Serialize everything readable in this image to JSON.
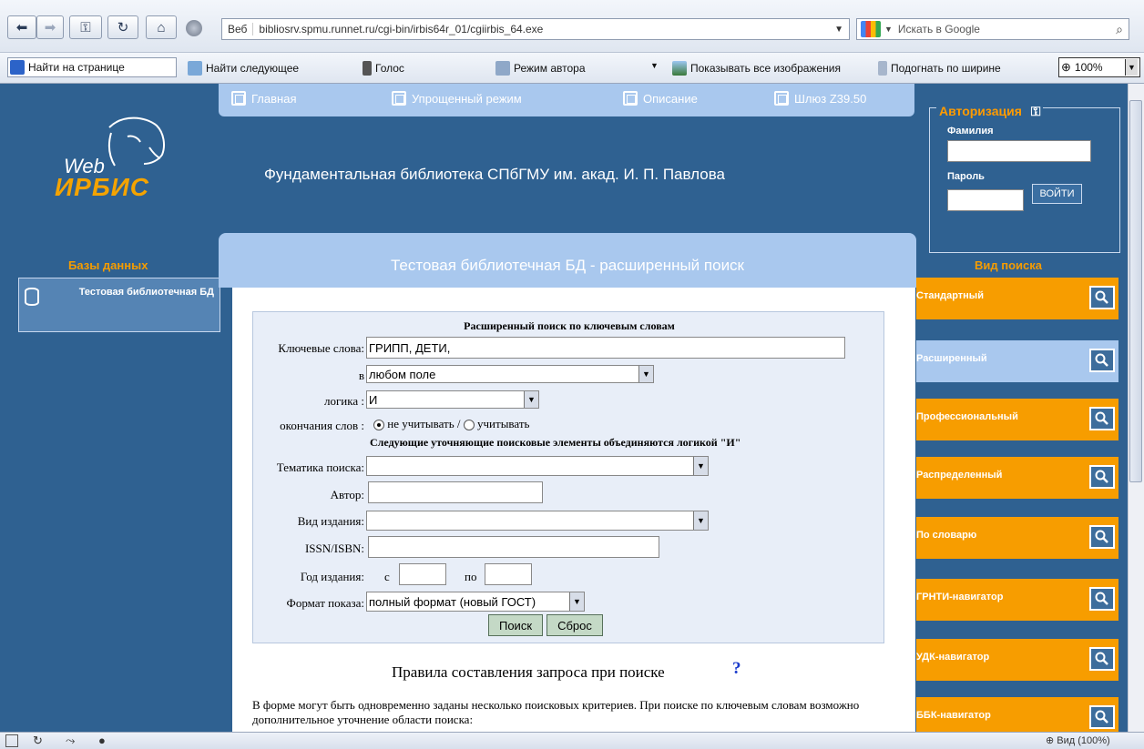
{
  "browser": {
    "address": "bibliosrv.spmu.runnet.ru/cgi-bin/irbis64r_01/cgiirbis_64.exe",
    "address_prefix": "Веб",
    "google_placeholder": "Искать в Google",
    "find_on_page": "Найти на странице",
    "find_next": "Найти следующее",
    "voice": "Голос",
    "author_mode": "Режим автора",
    "show_images": "Показывать все изображения",
    "fit_width": "Подогнать по ширине",
    "zoom": "100%",
    "status_zoom": "Вид (100%)"
  },
  "topnav": [
    "Главная",
    "Упрощенный режим",
    "Описание",
    "Шлюз Z39.50"
  ],
  "logo": {
    "web": "Web",
    "irbis": "ИРБИС"
  },
  "site_title": "Фундаментальная библиотека СПбГМУ им. акад. И. П. Павлова",
  "auth": {
    "title": "Авторизация",
    "surname_label": "Фамилия",
    "password_label": "Пароль",
    "login_button": "ВОЙТИ"
  },
  "databases": {
    "title": "Базы данных",
    "items": [
      "Тестовая библиотечная БД"
    ]
  },
  "search_header": "Тестовая библиотечная БД - расширенный поиск",
  "form": {
    "title": "Расширенный поиск по ключевым словам",
    "keywords_label": "Ключевые слова:",
    "keywords_value": "ГРИПП, ДЕТИ,",
    "in_label": "в",
    "in_value": "любом поле",
    "logic_label": "логика :",
    "logic_value": "И",
    "endings_label": "окончания слов :",
    "endings_opt1": "не учитывать /",
    "endings_opt2": "учитывать",
    "refine_note": "Следующие уточняющие поисковые элементы объединяются логикой \"И\"",
    "topic_label": "Тематика поиска:",
    "topic_value": "",
    "author_label": "Автор:",
    "author_value": "",
    "pubtype_label": "Вид издания:",
    "pubtype_value": "",
    "issn_label": "ISSN/ISBN:",
    "issn_value": "",
    "year_label": "Год издания:",
    "year_from_label": "с",
    "year_to_label": "по",
    "format_label": "Формат показа:",
    "format_value": "полный формат (новый ГОСТ)",
    "search_button": "Поиск",
    "reset_button": "Сброс"
  },
  "rules": {
    "title": "Правила составления запроса при поиске",
    "help": "?",
    "text": "В форме могут быть одновременно заданы несколько поисковых критериев. При поиске по ключевым словам возможно дополнительное уточнение области поиска:"
  },
  "search_types": {
    "title": "Вид поиска",
    "items": [
      "Стандартный",
      "Расширенный",
      "Профессиональный",
      "Распределенный",
      "По словарю",
      "ГРНТИ-навигатор",
      "УДК-навигатор",
      "ББК-навигатор"
    ],
    "active": "Расширенный"
  },
  "colors": {
    "page_bg": "#2f6191",
    "accent_orange": "#f79d00",
    "nav_light": "#a9c8ee"
  }
}
